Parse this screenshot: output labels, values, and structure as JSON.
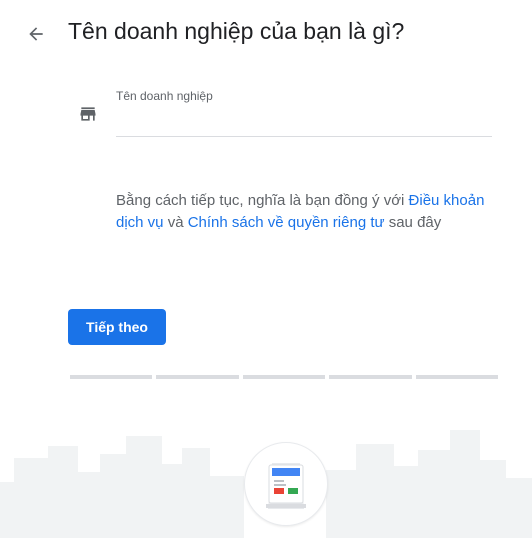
{
  "header": {
    "back_icon": "arrow-back-icon",
    "title": "Tên doanh nghiệp của bạn là gì?"
  },
  "form": {
    "field_icon": "storefront-icon",
    "field_label": "Tên doanh nghiệp",
    "field_value": ""
  },
  "terms": {
    "prefix": "Bằng cách tiếp tục, nghĩa là bạn đồng ý với ",
    "tos_link": "Điều khoản dịch vụ",
    "middle": " và ",
    "privacy_link": "Chính sách về quyền riêng tư",
    "suffix": " sau đây"
  },
  "actions": {
    "next_label": "Tiếp theo"
  },
  "progress": {
    "total_steps": 5,
    "current_step": 0
  },
  "illustration": {
    "icon": "business-sign-icon"
  },
  "colors": {
    "accent": "#1a73e8",
    "title_text": "#202124",
    "secondary_text": "#5f6368",
    "divider": "#dadce0",
    "skyline": "#f1f3f4"
  }
}
